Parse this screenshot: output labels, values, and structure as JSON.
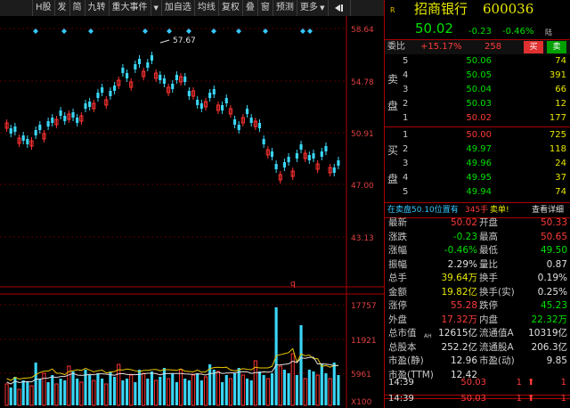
{
  "toolbar": {
    "items": [
      "H股",
      "发",
      "简",
      "九转",
      "重大事件"
    ],
    "dropdown": "▼",
    "items2": [
      "加自选",
      "均线",
      "复权",
      "叠",
      "窗",
      "预测"
    ],
    "more": "更多"
  },
  "chart": {
    "price_axis": [
      "58.64",
      "54.78",
      "50.91",
      "47.00",
      "43.13"
    ],
    "vol_axis": [
      "17757",
      "11921",
      "5961",
      "X100"
    ],
    "high_label": "57.67",
    "event_marker": "q",
    "colors": {
      "up": "#ff3232",
      "down": "#3ad6f6",
      "ma": "#e8c800"
    }
  },
  "quote": {
    "logo": "R",
    "name": "招商银行",
    "code": "600036",
    "price": "50.02",
    "change": "-0.23",
    "pct": "-0.46%",
    "tag": "陆",
    "webi_label": "委比",
    "webi": "+15.17%",
    "webi_diff": "258",
    "buy_btn": "买",
    "sell_btn": "卖",
    "sell_label": [
      "卖",
      "盘"
    ],
    "buy_label": [
      "买",
      "盘"
    ],
    "asks": [
      {
        "lvl": "5",
        "price": "50.06",
        "vol": "74"
      },
      {
        "lvl": "4",
        "price": "50.05",
        "vol": "391"
      },
      {
        "lvl": "3",
        "price": "50.04",
        "vol": "66"
      },
      {
        "lvl": "2",
        "price": "50.03",
        "vol": "12"
      },
      {
        "lvl": "1",
        "price": "50.02",
        "vol": "177"
      }
    ],
    "bids": [
      {
        "lvl": "1",
        "price": "50.00",
        "vol": "725"
      },
      {
        "lvl": "2",
        "price": "49.97",
        "vol": "118"
      },
      {
        "lvl": "3",
        "price": "49.96",
        "vol": "24"
      },
      {
        "lvl": "4",
        "price": "49.95",
        "vol": "37"
      },
      {
        "lvl": "5",
        "price": "49.94",
        "vol": "74"
      }
    ],
    "notice_a": "在卖盘50.10位置有",
    "notice_b": "345手",
    "notice_c": "卖单!",
    "notice_link": "查看详细",
    "stats": [
      {
        "l1": "最新",
        "v1": "50.02",
        "c1": "red",
        "l2": "开盘",
        "v2": "50.33",
        "c2": "red"
      },
      {
        "l1": "涨跌",
        "v1": "-0.23",
        "c1": "green",
        "l2": "最高",
        "v2": "50.65",
        "c2": "red"
      },
      {
        "l1": "涨幅",
        "v1": "-0.46%",
        "c1": "green",
        "l2": "最低",
        "v2": "49.50",
        "c2": "green"
      },
      {
        "l1": "振幅",
        "v1": "2.29%",
        "c1": "white",
        "l2": "量比",
        "v2": "0.87",
        "c2": "white"
      },
      {
        "l1": "总手",
        "v1": "39.64万",
        "c1": "yellow",
        "l2": "换手",
        "v2": "0.19%",
        "c2": "white"
      },
      {
        "l1": "金额",
        "v1": "19.82亿",
        "c1": "yellow",
        "l2": "换手(实)",
        "v2": "0.25%",
        "c2": "white"
      },
      {
        "l1": "涨停",
        "v1": "55.28",
        "c1": "red",
        "l2": "跌停",
        "v2": "45.23",
        "c2": "green"
      },
      {
        "l1": "外盘",
        "v1": "17.32万",
        "c1": "red",
        "l2": "内盘",
        "v2": "22.32万",
        "c2": "green"
      },
      {
        "l1": "总市值",
        "v1": "12615亿",
        "c1": "white",
        "l2": "流通值A",
        "v2": "10319亿",
        "c2": "white"
      },
      {
        "l1": "总股本",
        "v1": "252.2亿",
        "c1": "white",
        "l2": "流通股A",
        "v2": "206.3亿",
        "c2": "white"
      },
      {
        "l1": "市盈(静)",
        "v1": "12.96",
        "c1": "white",
        "l2": "市盈(动)",
        "v2": "9.85",
        "c2": "white"
      },
      {
        "l1": "市盈(TTM)",
        "v1": "12.42",
        "c1": "white",
        "l2": "",
        "v2": "",
        "c2": "white"
      }
    ],
    "gb_sup": "AH",
    "ticks": [
      {
        "time": "14:39",
        "price": "50.03",
        "vol": "1",
        "arrow": "⬆",
        "num": "1"
      },
      {
        "time": "14:39",
        "price": "50.03",
        "vol": "1",
        "arrow": "⬆",
        "num": "1"
      }
    ]
  }
}
